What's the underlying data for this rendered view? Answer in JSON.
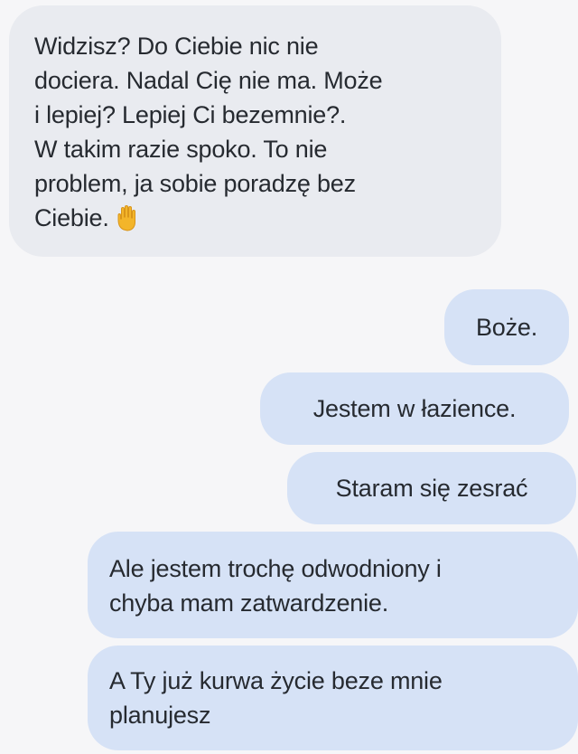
{
  "messages": [
    {
      "side": "received",
      "lines": [
        "Widzisz? Do Ciebie nic nie",
        "dociera. Nadal Cię nie ma. Może",
        "i lepiej? Lepiej Ci bezemnie?.",
        "W takim razie spoko. To nie",
        "problem, ja sobie poradzę bez",
        "Ciebie."
      ],
      "emoji": "raised-hand-icon"
    },
    {
      "side": "sent",
      "lines": [
        "Boże."
      ]
    },
    {
      "side": "sent",
      "lines": [
        "Jestem w łazience."
      ]
    },
    {
      "side": "sent",
      "lines": [
        "Staram się zesrać"
      ]
    },
    {
      "side": "sent",
      "lines": [
        "Ale jestem trochę odwodniony i",
        "chyba mam zatwardzenie."
      ]
    },
    {
      "side": "sent",
      "lines": [
        "A Ty już kurwa życie beze mnie",
        "planujesz"
      ]
    }
  ],
  "colors": {
    "background": "#f6f6f8",
    "received_bubble": "#e9ebf0",
    "sent_bubble": "#d6e2f6",
    "text": "#262a30",
    "emoji": "#f3b52a"
  }
}
